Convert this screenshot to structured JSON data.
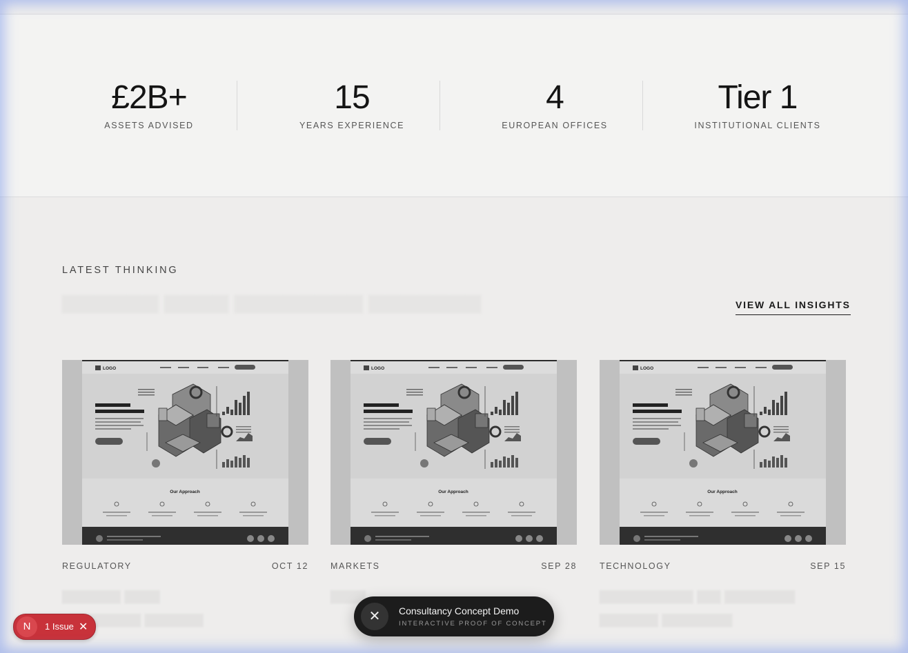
{
  "stats": [
    {
      "value": "£2B+",
      "label": "ASSETS ADVISED"
    },
    {
      "value": "15",
      "label": "YEARS EXPERIENCE"
    },
    {
      "value": "4",
      "label": "EUROPEAN OFFICES"
    },
    {
      "value": "Tier 1",
      "label": "INSTITUTIONAL CLIENTS"
    }
  ],
  "insights": {
    "eyebrow": "LATEST THINKING",
    "view_all": "VIEW ALL INSIGHTS",
    "cards": [
      {
        "category": "REGULATORY",
        "date": "OCT 12",
        "logo": "LOGO",
        "section": "Our Approach"
      },
      {
        "category": "MARKETS",
        "date": "SEP 28",
        "logo": "LOGO",
        "section": "Our Approach"
      },
      {
        "category": "TECHNOLOGY",
        "date": "SEP 15",
        "logo": "LOGO",
        "section": "Our Approach"
      }
    ]
  },
  "toast": {
    "title": "Consultancy Concept Demo",
    "subtitle": "INTERACTIVE PROOF OF CONCEPT",
    "close_icon": "close-icon"
  },
  "issue_badge": {
    "avatar": "N",
    "text": "1 Issue",
    "close_icon": "close-icon"
  },
  "colors": {
    "background": "#eeedec",
    "stats_background": "#f3f3f2",
    "toast_background": "#1c1c1c",
    "issue_red": "#c8323a"
  }
}
